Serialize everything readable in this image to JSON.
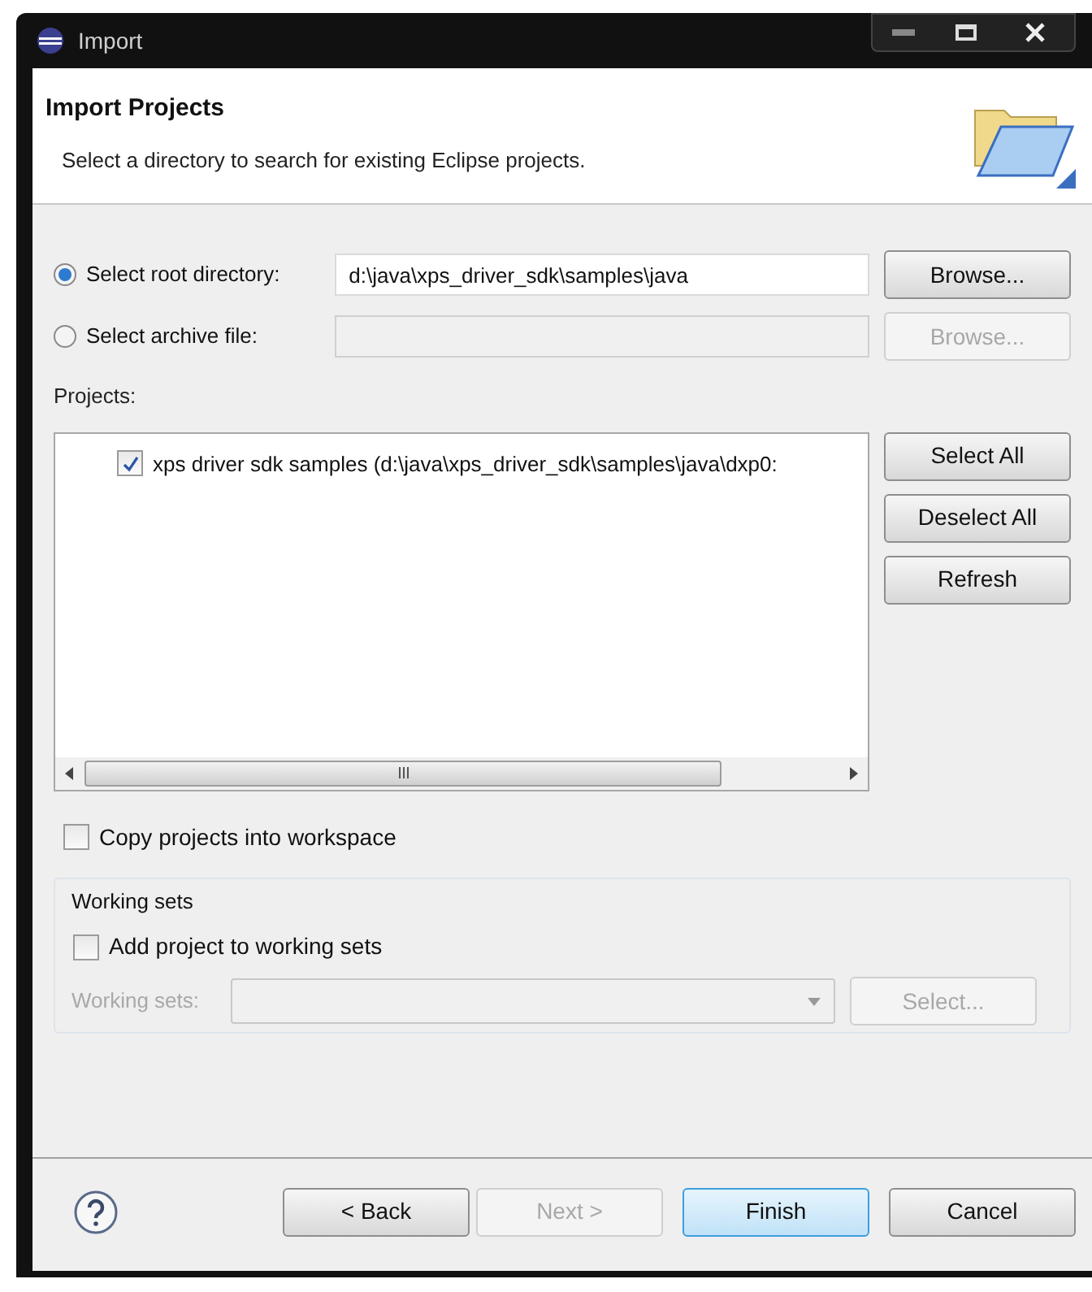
{
  "window": {
    "title": "Import"
  },
  "header": {
    "title": "Import Projects",
    "description": "Select a directory to search for existing Eclipse projects."
  },
  "sources": [
    {
      "label": "Select root directory:",
      "selected": true,
      "value": "d:\\java\\xps_driver_sdk\\samples\\java",
      "disabled": false,
      "button": {
        "label": "Browse...",
        "disabled": false
      }
    },
    {
      "label": "Select archive file:",
      "selected": false,
      "disabled": true,
      "button": {
        "label": "Browse...",
        "disabled": true
      }
    }
  ],
  "projects": {
    "label": "Projects:",
    "items": [
      {
        "label": "xps driver sdk samples (d:\\java\\xps_driver_sdk\\samples\\java\\dxp0:",
        "checked": true
      }
    ],
    "buttons": [
      {
        "label": "Select All"
      },
      {
        "label": "Deselect All"
      },
      {
        "label": "Refresh"
      }
    ]
  },
  "copy": {
    "label": "Copy projects into workspace",
    "checked": false
  },
  "working_sets": {
    "title": "Working sets",
    "add": {
      "label": "Add project to working sets",
      "checked": false
    },
    "field": {
      "label": "Working sets:",
      "disabled": true
    },
    "select_button": {
      "label": "Select...",
      "disabled": true
    }
  },
  "footer": {
    "buttons": [
      {
        "label": "< Back",
        "disabled": false,
        "default": false
      },
      {
        "label": "Next >",
        "disabled": true,
        "default": false
      },
      {
        "label": "Finish",
        "disabled": false,
        "default": true
      },
      {
        "label": "Cancel",
        "disabled": false,
        "default": false
      }
    ]
  }
}
